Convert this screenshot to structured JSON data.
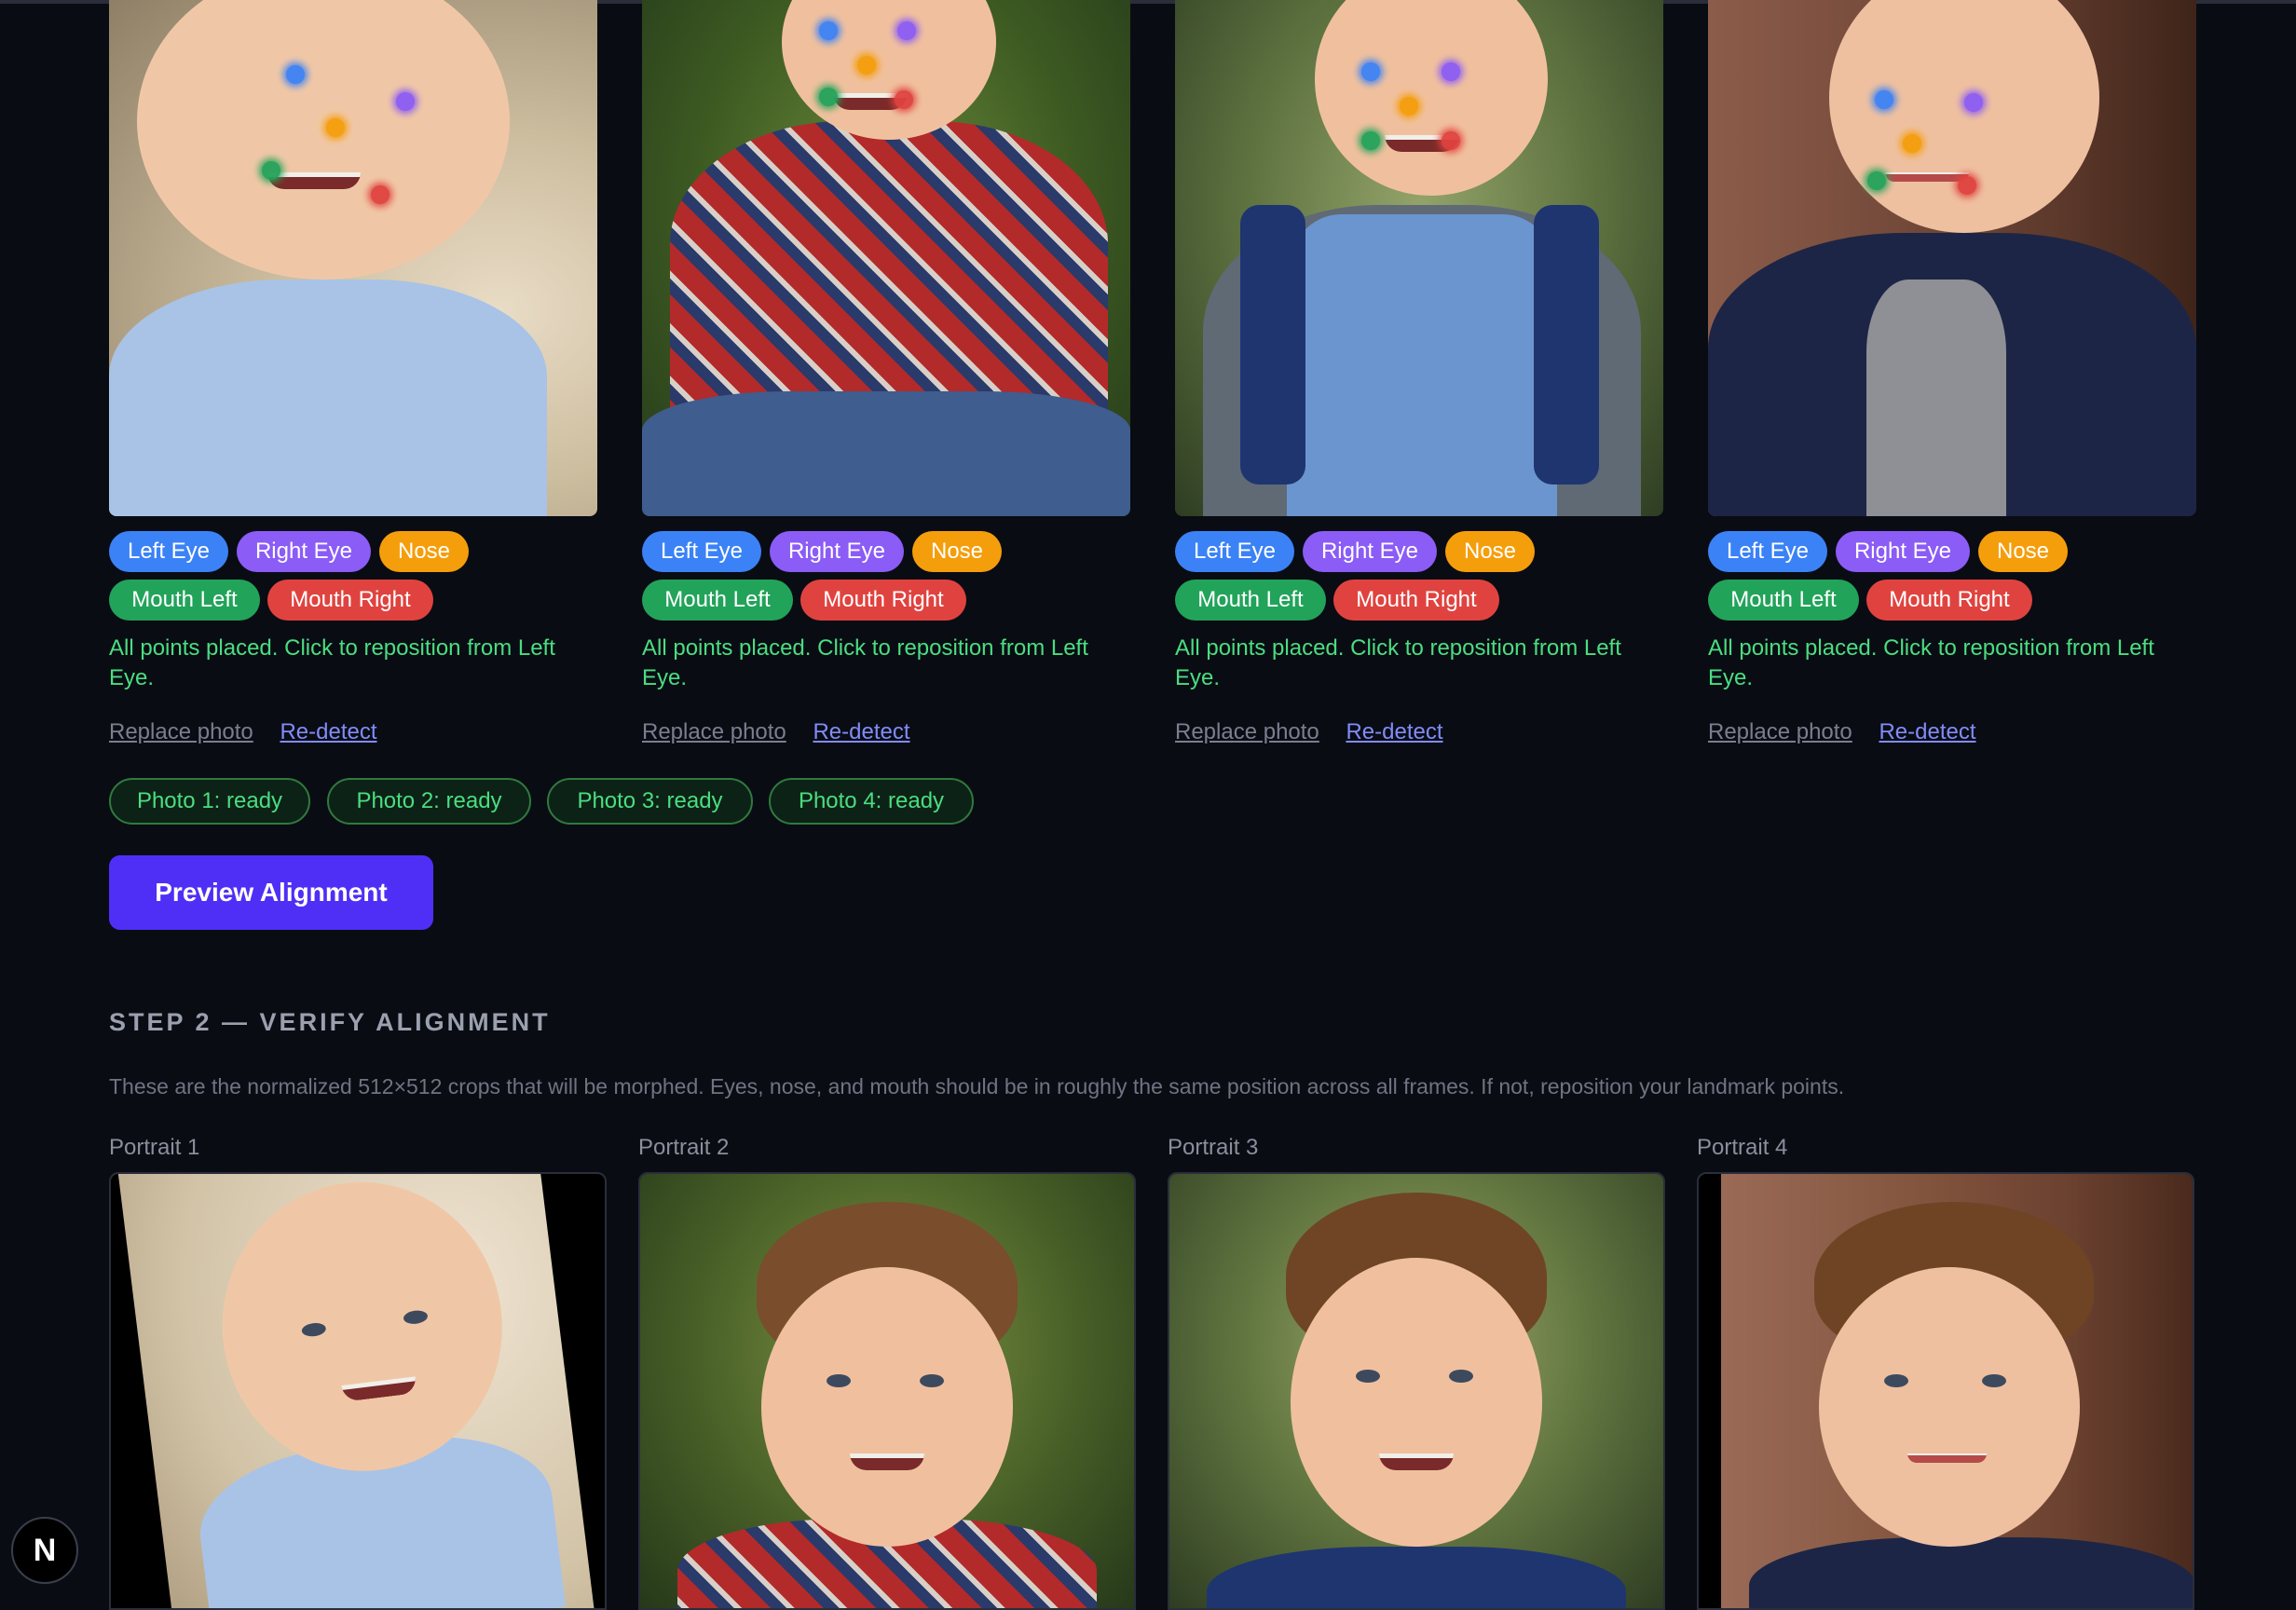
{
  "step1": {
    "cards": [
      {
        "chips": {
          "left_eye": "Left Eye",
          "right_eye": "Right Eye",
          "nose": "Nose",
          "mouth_left": "Mouth Left",
          "mouth_right": "Mouth Right"
        },
        "status": "All points placed. Click to reposition from Left Eye.",
        "replace": "Replace photo",
        "redetect": "Re-detect"
      },
      {
        "chips": {
          "left_eye": "Left Eye",
          "right_eye": "Right Eye",
          "nose": "Nose",
          "mouth_left": "Mouth Left",
          "mouth_right": "Mouth Right"
        },
        "status": "All points placed. Click to reposition from Left Eye.",
        "replace": "Replace photo",
        "redetect": "Re-detect"
      },
      {
        "chips": {
          "left_eye": "Left Eye",
          "right_eye": "Right Eye",
          "nose": "Nose",
          "mouth_left": "Mouth Left",
          "mouth_right": "Mouth Right"
        },
        "status": "All points placed. Click to reposition from Left Eye.",
        "replace": "Replace photo",
        "redetect": "Re-detect"
      },
      {
        "chips": {
          "left_eye": "Left Eye",
          "right_eye": "Right Eye",
          "nose": "Nose",
          "mouth_left": "Mouth Left",
          "mouth_right": "Mouth Right"
        },
        "status": "All points placed. Click to reposition from Left Eye.",
        "replace": "Replace photo",
        "redetect": "Re-detect"
      }
    ],
    "status_pills": [
      "Photo 1: ready",
      "Photo 2: ready",
      "Photo 3: ready",
      "Photo 4: ready"
    ],
    "preview_button": "Preview Alignment"
  },
  "step2": {
    "title": "STEP 2 — VERIFY ALIGNMENT",
    "description": "These are the normalized 512×512 crops that will be morphed. Eyes, nose, and mouth should be in roughly the same position across all frames. If not, reposition your landmark points.",
    "portraits": [
      "Portrait 1",
      "Portrait 2",
      "Portrait 3",
      "Portrait 4"
    ]
  },
  "colors": {
    "left_eye": "#3b82f6",
    "right_eye": "#8b5cf6",
    "nose": "#f59e0b",
    "mouth_left": "#22a35a",
    "mouth_right": "#e0433f",
    "ready": "#4ade80",
    "primary_button": "#4f2ff5"
  },
  "badge": {
    "label": "N"
  }
}
